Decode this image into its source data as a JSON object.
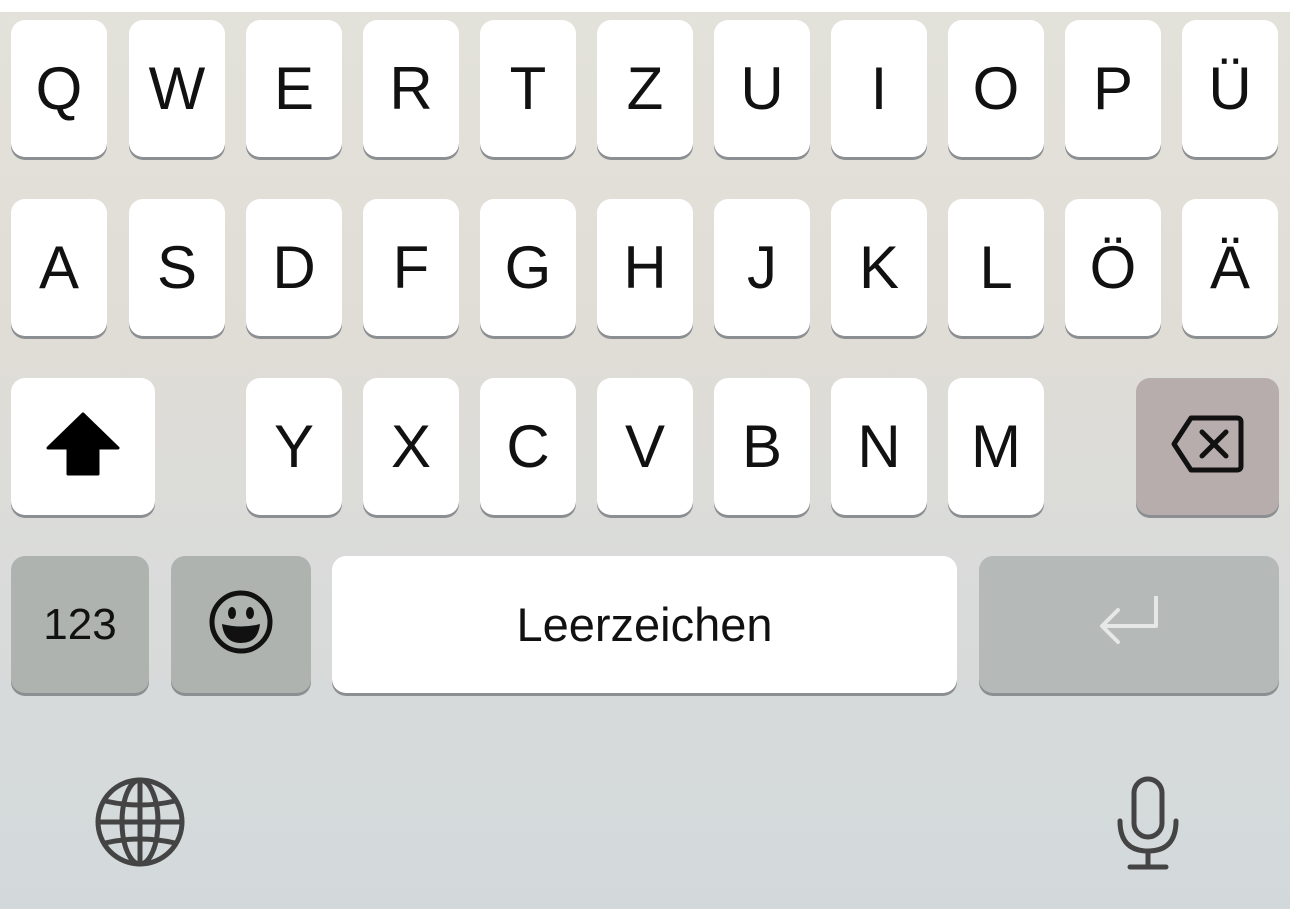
{
  "keyboard": {
    "rows": [
      [
        "Q",
        "W",
        "E",
        "R",
        "T",
        "Z",
        "U",
        "I",
        "O",
        "P",
        "Ü"
      ],
      [
        "A",
        "S",
        "D",
        "F",
        "G",
        "H",
        "J",
        "K",
        "L",
        "Ö",
        "Ä"
      ],
      [
        "Y",
        "X",
        "C",
        "V",
        "B",
        "N",
        "M"
      ]
    ],
    "numbers_label": "123",
    "space_label": "Leerzeichen",
    "icons": {
      "shift": "shift-icon",
      "backspace": "backspace-icon",
      "emoji": "emoji-icon",
      "return": "return-icon",
      "globe": "globe-icon",
      "mic": "microphone-icon"
    }
  }
}
